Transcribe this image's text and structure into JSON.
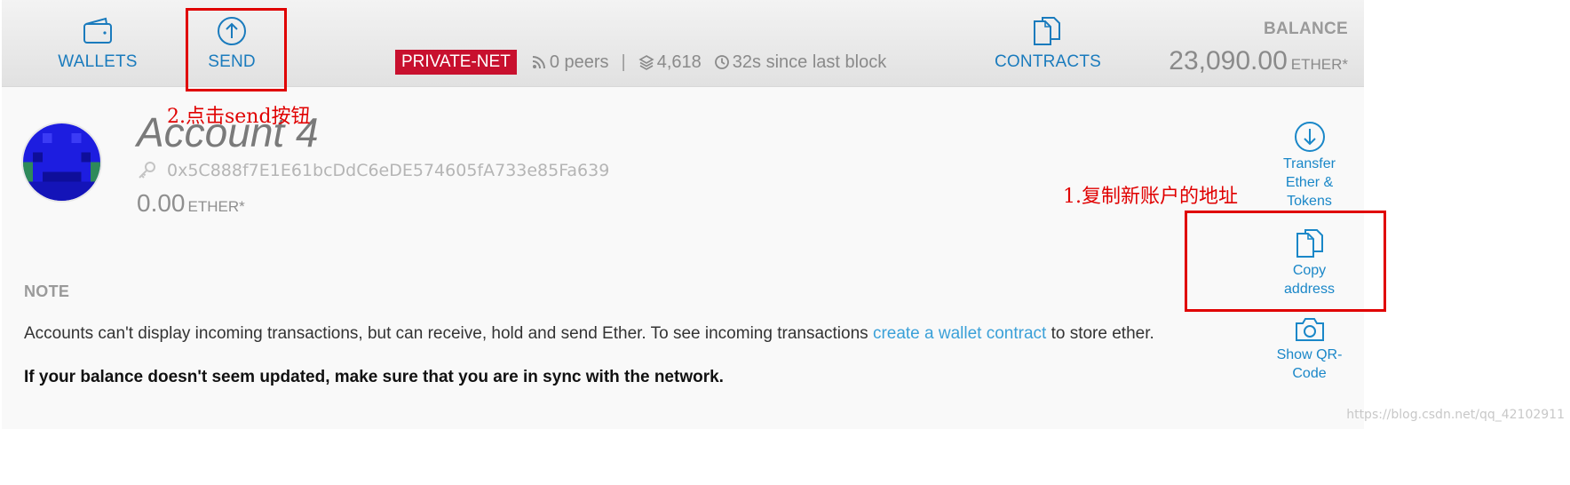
{
  "header": {
    "nav": {
      "wallets_label": "WALLETS",
      "send_label": "SEND",
      "contracts_label": "CONTRACTS"
    },
    "network": {
      "badge": "PRIVATE-NET",
      "peers": "0 peers",
      "separator": "|",
      "block_number": "4,618",
      "last_block": "32s since last block"
    },
    "balance": {
      "label": "BALANCE",
      "amount": "23,090.00",
      "unit": "ETHER*"
    }
  },
  "account": {
    "title": "Account 4",
    "address": "0x5C888f7E1E61bcDdC6eDE574605fA733e85Fa639",
    "balance_amount": "0.00",
    "balance_unit": "ETHER*"
  },
  "note": {
    "heading": "NOTE",
    "text_before_link": "Accounts can't display incoming transactions, but can receive, hold and send Ether. To see incoming transactions ",
    "link_text": "create a wallet contract",
    "text_after_link": " to store ether.",
    "warning": "If your balance doesn't seem updated, make sure that you are in sync with the network."
  },
  "actions": {
    "transfer": "Transfer\nEther &\nTokens",
    "copy_address": "Copy\naddress",
    "show_qr": "Show QR-\nCode"
  },
  "annotations": {
    "step_send": "2.点击send按钮",
    "step_copy": "1.复制新账户的地址"
  },
  "watermark": "https://blog.csdn.net/qq_42102911",
  "icons": {
    "wallets": "wallet-icon",
    "send": "arrow-up-circle-icon",
    "contracts": "documents-icon",
    "peers": "signal-icon",
    "block": "layers-icon",
    "time": "clock-icon",
    "address": "key-icon",
    "transfer": "arrow-down-circle-icon",
    "copy": "documents-icon",
    "qr": "camera-icon"
  },
  "colors": {
    "accent": "#1a7bbd",
    "network_badge": "#c8102e",
    "annotation": "#e00000",
    "link": "#3aa0d8"
  }
}
